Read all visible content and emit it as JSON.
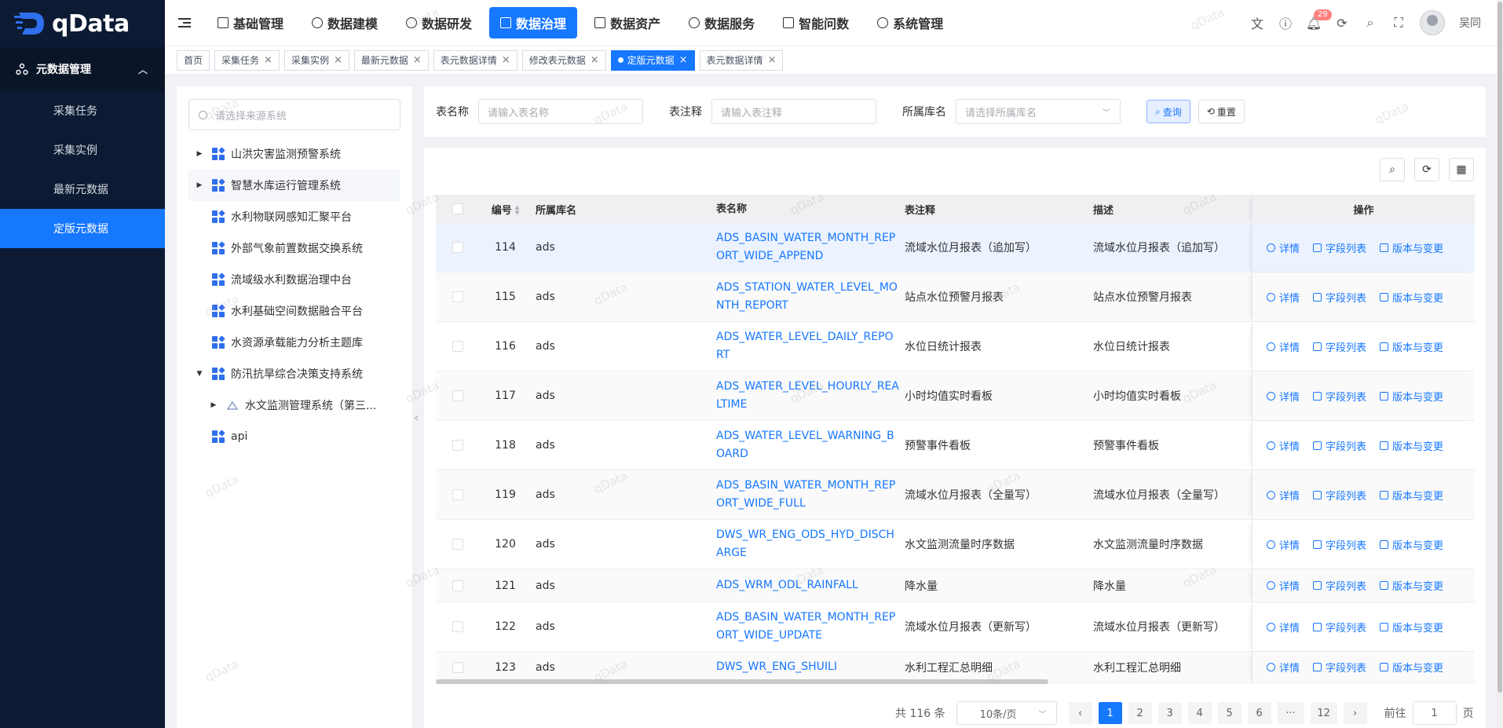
{
  "app": {
    "logo_text": "qData"
  },
  "sidebar": {
    "group_label": "元数据管理",
    "items": [
      {
        "label": "采集任务"
      },
      {
        "label": "采集实例"
      },
      {
        "label": "最新元数据"
      },
      {
        "label": "定版元数据",
        "active": true
      }
    ]
  },
  "header": {
    "nav": [
      {
        "label": "基础管理"
      },
      {
        "label": "数据建模"
      },
      {
        "label": "数据研发"
      },
      {
        "label": "数据治理",
        "active": true
      },
      {
        "label": "数据资产"
      },
      {
        "label": "数据服务"
      },
      {
        "label": "智能问数"
      },
      {
        "label": "系统管理"
      }
    ],
    "notification_count": "29",
    "user_name": "吴同"
  },
  "tabs": [
    {
      "label": "首页",
      "closable": false
    },
    {
      "label": "采集任务"
    },
    {
      "label": "采集实例"
    },
    {
      "label": "最新元数据"
    },
    {
      "label": "表元数据详情"
    },
    {
      "label": "修改表元数据"
    },
    {
      "label": "定版元数据",
      "active": true
    },
    {
      "label": "表元数据详情"
    }
  ],
  "tree": {
    "search_placeholder": "请选择来源系统",
    "nodes": [
      {
        "label": "山洪灾害监测预警系统",
        "arrow": "right",
        "level": 0
      },
      {
        "label": "智慧水库运行管理系统",
        "arrow": "right",
        "level": 0
      },
      {
        "label": "水利物联网感知汇聚平台",
        "arrow": "",
        "level": 0
      },
      {
        "label": "外部气象前置数据交换系统",
        "arrow": "",
        "level": 0
      },
      {
        "label": "流域级水利数据治理中台",
        "arrow": "",
        "level": 0
      },
      {
        "label": "水利基础空间数据融合平台",
        "arrow": "",
        "level": 0
      },
      {
        "label": "水资源承载能力分析主题库",
        "arrow": "",
        "level": 0
      },
      {
        "label": "防汛抗旱综合决策支持系统",
        "arrow": "down",
        "level": 0
      },
      {
        "label": "水文监测管理系统（第三...",
        "arrow": "right",
        "level": 1
      },
      {
        "label": "api",
        "arrow": "",
        "level": 0
      }
    ]
  },
  "filter": {
    "table_name_label": "表名称",
    "table_name_placeholder": "请输入表名称",
    "comment_label": "表注释",
    "comment_placeholder": "请输入表注释",
    "db_label": "所属库名",
    "db_placeholder": "请选择所属库名",
    "query_label": "查询",
    "reset_label": "重置"
  },
  "table": {
    "headers": {
      "id": "编号",
      "db": "所属库名",
      "name": "表名称",
      "comment": "表注释",
      "desc": "描述",
      "ops": "操作"
    },
    "op_labels": {
      "detail": "详情",
      "fields": "字段列表",
      "version": "版本与变更"
    },
    "rows": [
      {
        "id": "114",
        "db": "ads",
        "name": "ADS_BASIN_WATER_MONTH_REPORT_WIDE_APPEND",
        "comment": "流域水位月报表（追加写）",
        "desc": "流域水位月报表（追加写）"
      },
      {
        "id": "115",
        "db": "ads",
        "name": "ADS_STATION_WATER_LEVEL_MONTH_REPORT",
        "comment": "站点水位预警月报表",
        "desc": "站点水位预警月报表"
      },
      {
        "id": "116",
        "db": "ads",
        "name": "ADS_WATER_LEVEL_DAILY_REPORT",
        "comment": "水位日统计报表",
        "desc": "水位日统计报表"
      },
      {
        "id": "117",
        "db": "ads",
        "name": "ADS_WATER_LEVEL_HOURLY_REALTIME",
        "comment": "小时均值实时看板",
        "desc": "小时均值实时看板"
      },
      {
        "id": "118",
        "db": "ads",
        "name": "ADS_WATER_LEVEL_WARNING_BOARD",
        "comment": "预警事件看板",
        "desc": "预警事件看板"
      },
      {
        "id": "119",
        "db": "ads",
        "name": "ADS_BASIN_WATER_MONTH_REPORT_WIDE_FULL",
        "comment": "流域水位月报表（全量写）",
        "desc": "流域水位月报表（全量写）"
      },
      {
        "id": "120",
        "db": "ads",
        "name": "DWS_WR_ENG_ODS_HYD_DISCHARGE",
        "comment": "水文监测流量时序数据",
        "desc": "水文监测流量时序数据"
      },
      {
        "id": "121",
        "db": "ads",
        "name": "ADS_WRM_ODL_RAINFALL",
        "comment": "降水量",
        "desc": "降水量"
      },
      {
        "id": "122",
        "db": "ads",
        "name": "ADS_BASIN_WATER_MONTH_REPORT_WIDE_UPDATE",
        "comment": "流域水位月报表（更新写）",
        "desc": "流域水位月报表（更新写）"
      },
      {
        "id": "123",
        "db": "ads",
        "name": "DWS_WR_ENG_SHUILI",
        "comment": "水利工程汇总明细",
        "desc": "水利工程汇总明细"
      }
    ]
  },
  "pager": {
    "total_text": "共 116 条",
    "page_size": "10条/页",
    "pages": [
      "1",
      "2",
      "3",
      "4",
      "5",
      "6",
      "···",
      "12"
    ],
    "current": "1",
    "jump_prefix": "前往",
    "jump_value": "1",
    "jump_suffix": "页"
  },
  "watermark": "qData"
}
